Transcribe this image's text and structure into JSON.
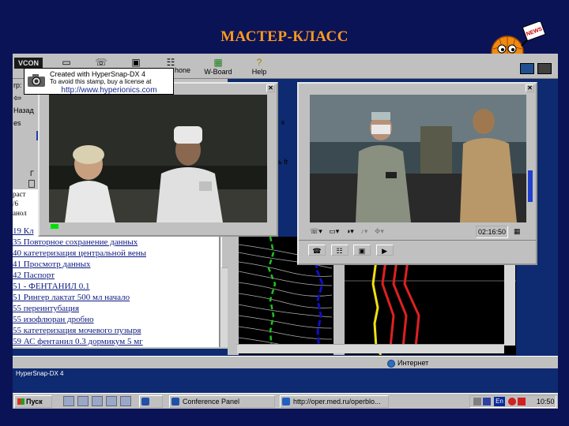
{
  "slide": {
    "title": "МАСТЕР-КЛАСС"
  },
  "colors": {
    "slide_bg": "#0b1357",
    "title": "#ff9a1a",
    "link": "#0c1a80",
    "trace_yellow": "#f0e010",
    "trace_red": "#e02020",
    "trace_blue": "#1010c0",
    "trace_green": "#20c020"
  },
  "mascot": {
    "badge": "NEWS"
  },
  "vcon": {
    "logo": "VCON",
    "toolbar": [
      {
        "label": "",
        "icon": "monitor-icon"
      },
      {
        "label": "",
        "icon": "phone-icon"
      },
      {
        "label": "",
        "icon": "camera-icon"
      },
      {
        "label": "",
        "icon": "people-icon"
      },
      {
        "label": "hone",
        "icon": "phone-icon"
      },
      {
        "label": "W-Board",
        "icon": "whiteboard-icon"
      },
      {
        "label": "Help",
        "icon": "help-icon"
      }
    ]
  },
  "stamp": {
    "line1": "Created with HyperSnap-DX 4",
    "line2": "To avoid this stamp, buy a license at",
    "url": "http://www.hyperionics.com"
  },
  "browser": {
    "side_labels": [
      "rp:",
      "⇦",
      "Назад",
      "es",
      "",
      "",
      "",
      "Г"
    ],
    "fragments": [
      "раст",
      "/6",
      "анол"
    ],
    "log_lines": [
      "19 Кл",
      "35 Повторное сохранение данных",
      "40 катетеризация центральной вены",
      "41 Просмотр данных",
      "42 Паспорт",
      "51 - ФЕНТАНИЛ 0.1",
      "51 Рингер лактат 500 мл начало",
      "55 переинтубация",
      "55 изофлюран дробно",
      "55 катетеризация мочевого пузыря",
      "59 АС фентанил 0.3 дормикум 5 мг"
    ],
    "toolbar_fragments": [
      "к",
      "ь fr"
    ]
  },
  "video_window_1": {
    "title_hint": ""
  },
  "video_window_2": {
    "timecode": "02:16:50",
    "controls": [
      "phone-icon",
      "screen-icon",
      "contrast-icon",
      "audio-icon",
      "move-icon"
    ]
  },
  "status_bar": {
    "zone": "Интернет"
  },
  "hypersnap_tray_label": "HyperSnap-DX 4",
  "taskbar": {
    "start": "Пуск",
    "items": [
      {
        "label": "",
        "icon": "hypersnap-icon"
      },
      {
        "label": "Conference Panel",
        "icon": "conference-icon"
      },
      {
        "label": "http://oper.med.ru/operblo...",
        "icon": "ie-icon"
      }
    ],
    "lang": "En",
    "clock": "10:50"
  }
}
